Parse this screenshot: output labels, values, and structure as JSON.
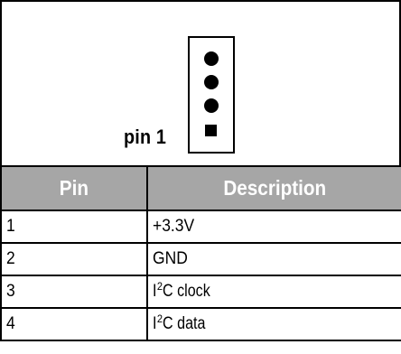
{
  "diagram": {
    "pin_label": "pin 1",
    "connector": {
      "pin_count": 4,
      "pin_1_shape": "square",
      "other_pin_shape": "round",
      "pin_icons": [
        "round-pin-icon",
        "round-pin-icon",
        "round-pin-icon",
        "square-pin-icon"
      ]
    }
  },
  "table": {
    "headers": [
      "Pin",
      "Description"
    ],
    "header_background": "#a6a6a6",
    "header_text_color": "#ffffff",
    "rows": [
      {
        "pin": "1",
        "description": "+3.3V"
      },
      {
        "pin": "2",
        "description": "GND"
      },
      {
        "pin": "3",
        "description_prefix": "I",
        "description_sup": "2",
        "description_suffix": "C clock"
      },
      {
        "pin": "4",
        "description_prefix": "I",
        "description_sup": "2",
        "description_suffix": "C data"
      }
    ]
  }
}
